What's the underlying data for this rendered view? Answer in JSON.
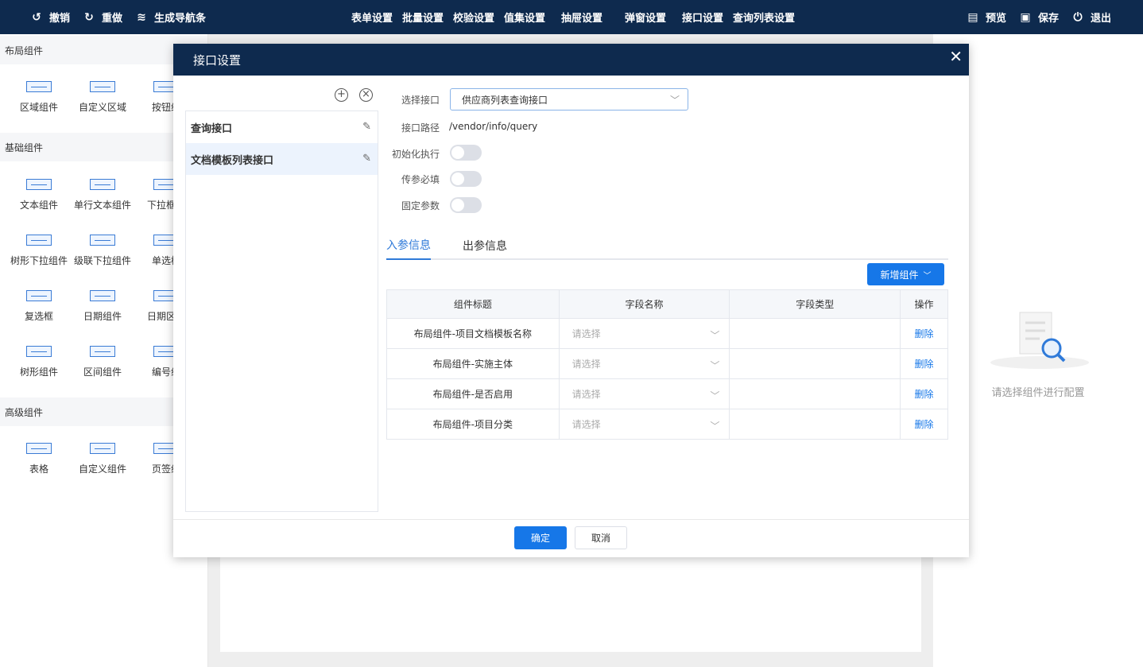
{
  "toolbar": {
    "undo": "撤销",
    "redo": "重做",
    "gen_nav": "生成导航条",
    "form_settings": "表单设置",
    "batch_settings": "批量设置",
    "validate_settings": "校验设置",
    "valueset_settings": "值集设置",
    "drawer_settings": "抽屉设置",
    "popup_settings": "弹窗设置",
    "api_settings": "接口设置",
    "query_list_settings": "查询列表设置",
    "preview": "预览",
    "save": "保存",
    "exit": "退出"
  },
  "palette": {
    "layout_title": "布局组件",
    "layout_items": [
      "区域组件",
      "自定义区域",
      "按钮组"
    ],
    "basic_title": "基础组件",
    "basic_items": [
      "文本组件",
      "单行文本组件",
      "下拉框组",
      "树形下拉组件",
      "级联下拉组件",
      "单选框",
      "复选框",
      "日期组件",
      "日期区间",
      "树形组件",
      "区间组件",
      "编号组"
    ],
    "advanced_title": "高级组件",
    "advanced_items": [
      "表格",
      "自定义组件",
      "页签组"
    ]
  },
  "right_panel": {
    "empty_text": "请选择组件进行配置"
  },
  "modal": {
    "title": "接口设置",
    "api_list": [
      "查询接口",
      "文档模板列表接口"
    ],
    "labels": {
      "select_api": "选择接口",
      "api_path": "接口路径",
      "init_exec": "初始化执行",
      "param_required": "传参必填",
      "fixed_param": "固定参数"
    },
    "selected_api": "供应商列表查询接口",
    "api_path_value": "/vendor/info/query",
    "toggles": {
      "init_exec": false,
      "param_required": false,
      "fixed_param": false
    },
    "tabs": [
      "入参信息",
      "出参信息"
    ],
    "add_component_label": "新增组件",
    "table": {
      "headers": [
        "组件标题",
        "字段名称",
        "字段类型",
        "操作"
      ],
      "placeholder": "请选择",
      "delete_label": "删除",
      "rows": [
        "布局组件-项目文档模板名称",
        "布局组件-实施主体",
        "布局组件-是否启用",
        "布局组件-项目分类"
      ]
    },
    "ok": "确定",
    "cancel": "取消"
  },
  "colors": {
    "header_bg": "#0e2a4e",
    "primary": "#1677e8"
  }
}
